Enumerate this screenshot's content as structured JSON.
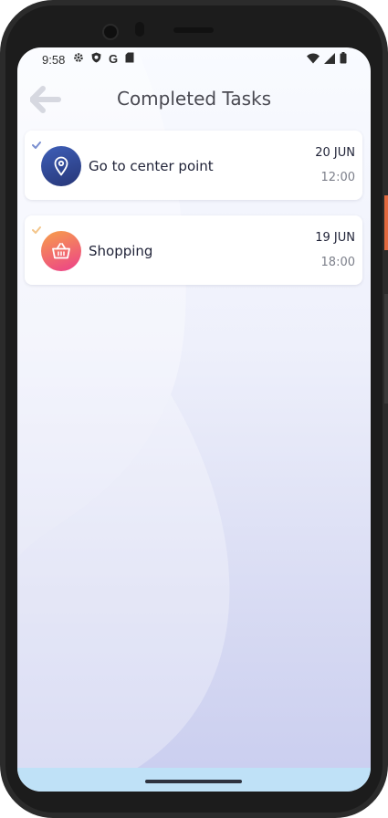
{
  "status_bar": {
    "time": "9:58",
    "left_icons": [
      "gear-icon",
      "shield-icon",
      "google-g-icon",
      "sd-card-icon"
    ],
    "right_icons": [
      "wifi-icon",
      "signal-icon",
      "battery-icon"
    ]
  },
  "app_bar": {
    "back_icon": "arrow-left-icon",
    "title": "Completed Tasks"
  },
  "tasks": [
    {
      "title": "Go to center point",
      "date": "20 JUN",
      "time": "12:00",
      "icon": "location-pin-icon",
      "icon_gradient": [
        "#3e5fb8",
        "#273677"
      ],
      "check_color": "#7a8fd0"
    },
    {
      "title": "Shopping",
      "date": "19 JUN",
      "time": "18:00",
      "icon": "shopping-basket-icon",
      "icon_gradient": [
        "#f7a04a",
        "#ec3f8a"
      ],
      "check_color": "#f3c58a"
    }
  ]
}
